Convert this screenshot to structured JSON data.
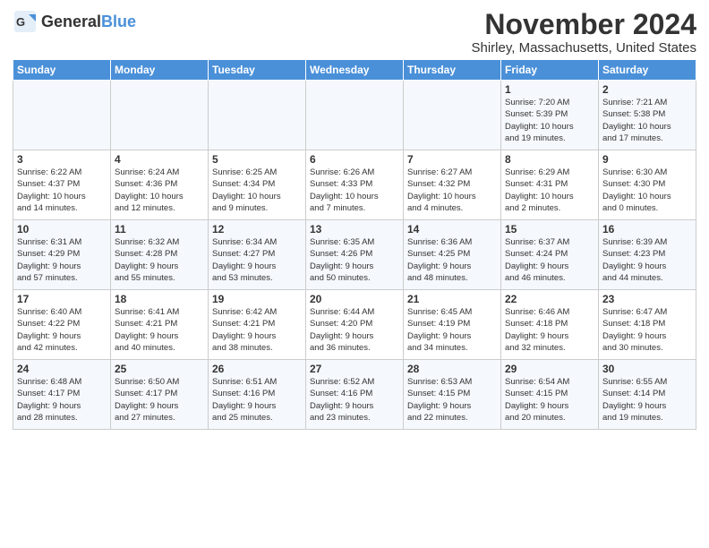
{
  "header": {
    "logo_general": "General",
    "logo_blue": "Blue",
    "title": "November 2024",
    "location": "Shirley, Massachusetts, United States"
  },
  "weekdays": [
    "Sunday",
    "Monday",
    "Tuesday",
    "Wednesday",
    "Thursday",
    "Friday",
    "Saturday"
  ],
  "weeks": [
    [
      {
        "day": "",
        "info": ""
      },
      {
        "day": "",
        "info": ""
      },
      {
        "day": "",
        "info": ""
      },
      {
        "day": "",
        "info": ""
      },
      {
        "day": "",
        "info": ""
      },
      {
        "day": "1",
        "info": "Sunrise: 7:20 AM\nSunset: 5:39 PM\nDaylight: 10 hours\nand 19 minutes."
      },
      {
        "day": "2",
        "info": "Sunrise: 7:21 AM\nSunset: 5:38 PM\nDaylight: 10 hours\nand 17 minutes."
      }
    ],
    [
      {
        "day": "3",
        "info": "Sunrise: 6:22 AM\nSunset: 4:37 PM\nDaylight: 10 hours\nand 14 minutes."
      },
      {
        "day": "4",
        "info": "Sunrise: 6:24 AM\nSunset: 4:36 PM\nDaylight: 10 hours\nand 12 minutes."
      },
      {
        "day": "5",
        "info": "Sunrise: 6:25 AM\nSunset: 4:34 PM\nDaylight: 10 hours\nand 9 minutes."
      },
      {
        "day": "6",
        "info": "Sunrise: 6:26 AM\nSunset: 4:33 PM\nDaylight: 10 hours\nand 7 minutes."
      },
      {
        "day": "7",
        "info": "Sunrise: 6:27 AM\nSunset: 4:32 PM\nDaylight: 10 hours\nand 4 minutes."
      },
      {
        "day": "8",
        "info": "Sunrise: 6:29 AM\nSunset: 4:31 PM\nDaylight: 10 hours\nand 2 minutes."
      },
      {
        "day": "9",
        "info": "Sunrise: 6:30 AM\nSunset: 4:30 PM\nDaylight: 10 hours\nand 0 minutes."
      }
    ],
    [
      {
        "day": "10",
        "info": "Sunrise: 6:31 AM\nSunset: 4:29 PM\nDaylight: 9 hours\nand 57 minutes."
      },
      {
        "day": "11",
        "info": "Sunrise: 6:32 AM\nSunset: 4:28 PM\nDaylight: 9 hours\nand 55 minutes."
      },
      {
        "day": "12",
        "info": "Sunrise: 6:34 AM\nSunset: 4:27 PM\nDaylight: 9 hours\nand 53 minutes."
      },
      {
        "day": "13",
        "info": "Sunrise: 6:35 AM\nSunset: 4:26 PM\nDaylight: 9 hours\nand 50 minutes."
      },
      {
        "day": "14",
        "info": "Sunrise: 6:36 AM\nSunset: 4:25 PM\nDaylight: 9 hours\nand 48 minutes."
      },
      {
        "day": "15",
        "info": "Sunrise: 6:37 AM\nSunset: 4:24 PM\nDaylight: 9 hours\nand 46 minutes."
      },
      {
        "day": "16",
        "info": "Sunrise: 6:39 AM\nSunset: 4:23 PM\nDaylight: 9 hours\nand 44 minutes."
      }
    ],
    [
      {
        "day": "17",
        "info": "Sunrise: 6:40 AM\nSunset: 4:22 PM\nDaylight: 9 hours\nand 42 minutes."
      },
      {
        "day": "18",
        "info": "Sunrise: 6:41 AM\nSunset: 4:21 PM\nDaylight: 9 hours\nand 40 minutes."
      },
      {
        "day": "19",
        "info": "Sunrise: 6:42 AM\nSunset: 4:21 PM\nDaylight: 9 hours\nand 38 minutes."
      },
      {
        "day": "20",
        "info": "Sunrise: 6:44 AM\nSunset: 4:20 PM\nDaylight: 9 hours\nand 36 minutes."
      },
      {
        "day": "21",
        "info": "Sunrise: 6:45 AM\nSunset: 4:19 PM\nDaylight: 9 hours\nand 34 minutes."
      },
      {
        "day": "22",
        "info": "Sunrise: 6:46 AM\nSunset: 4:18 PM\nDaylight: 9 hours\nand 32 minutes."
      },
      {
        "day": "23",
        "info": "Sunrise: 6:47 AM\nSunset: 4:18 PM\nDaylight: 9 hours\nand 30 minutes."
      }
    ],
    [
      {
        "day": "24",
        "info": "Sunrise: 6:48 AM\nSunset: 4:17 PM\nDaylight: 9 hours\nand 28 minutes."
      },
      {
        "day": "25",
        "info": "Sunrise: 6:50 AM\nSunset: 4:17 PM\nDaylight: 9 hours\nand 27 minutes."
      },
      {
        "day": "26",
        "info": "Sunrise: 6:51 AM\nSunset: 4:16 PM\nDaylight: 9 hours\nand 25 minutes."
      },
      {
        "day": "27",
        "info": "Sunrise: 6:52 AM\nSunset: 4:16 PM\nDaylight: 9 hours\nand 23 minutes."
      },
      {
        "day": "28",
        "info": "Sunrise: 6:53 AM\nSunset: 4:15 PM\nDaylight: 9 hours\nand 22 minutes."
      },
      {
        "day": "29",
        "info": "Sunrise: 6:54 AM\nSunset: 4:15 PM\nDaylight: 9 hours\nand 20 minutes."
      },
      {
        "day": "30",
        "info": "Sunrise: 6:55 AM\nSunset: 4:14 PM\nDaylight: 9 hours\nand 19 minutes."
      }
    ]
  ]
}
